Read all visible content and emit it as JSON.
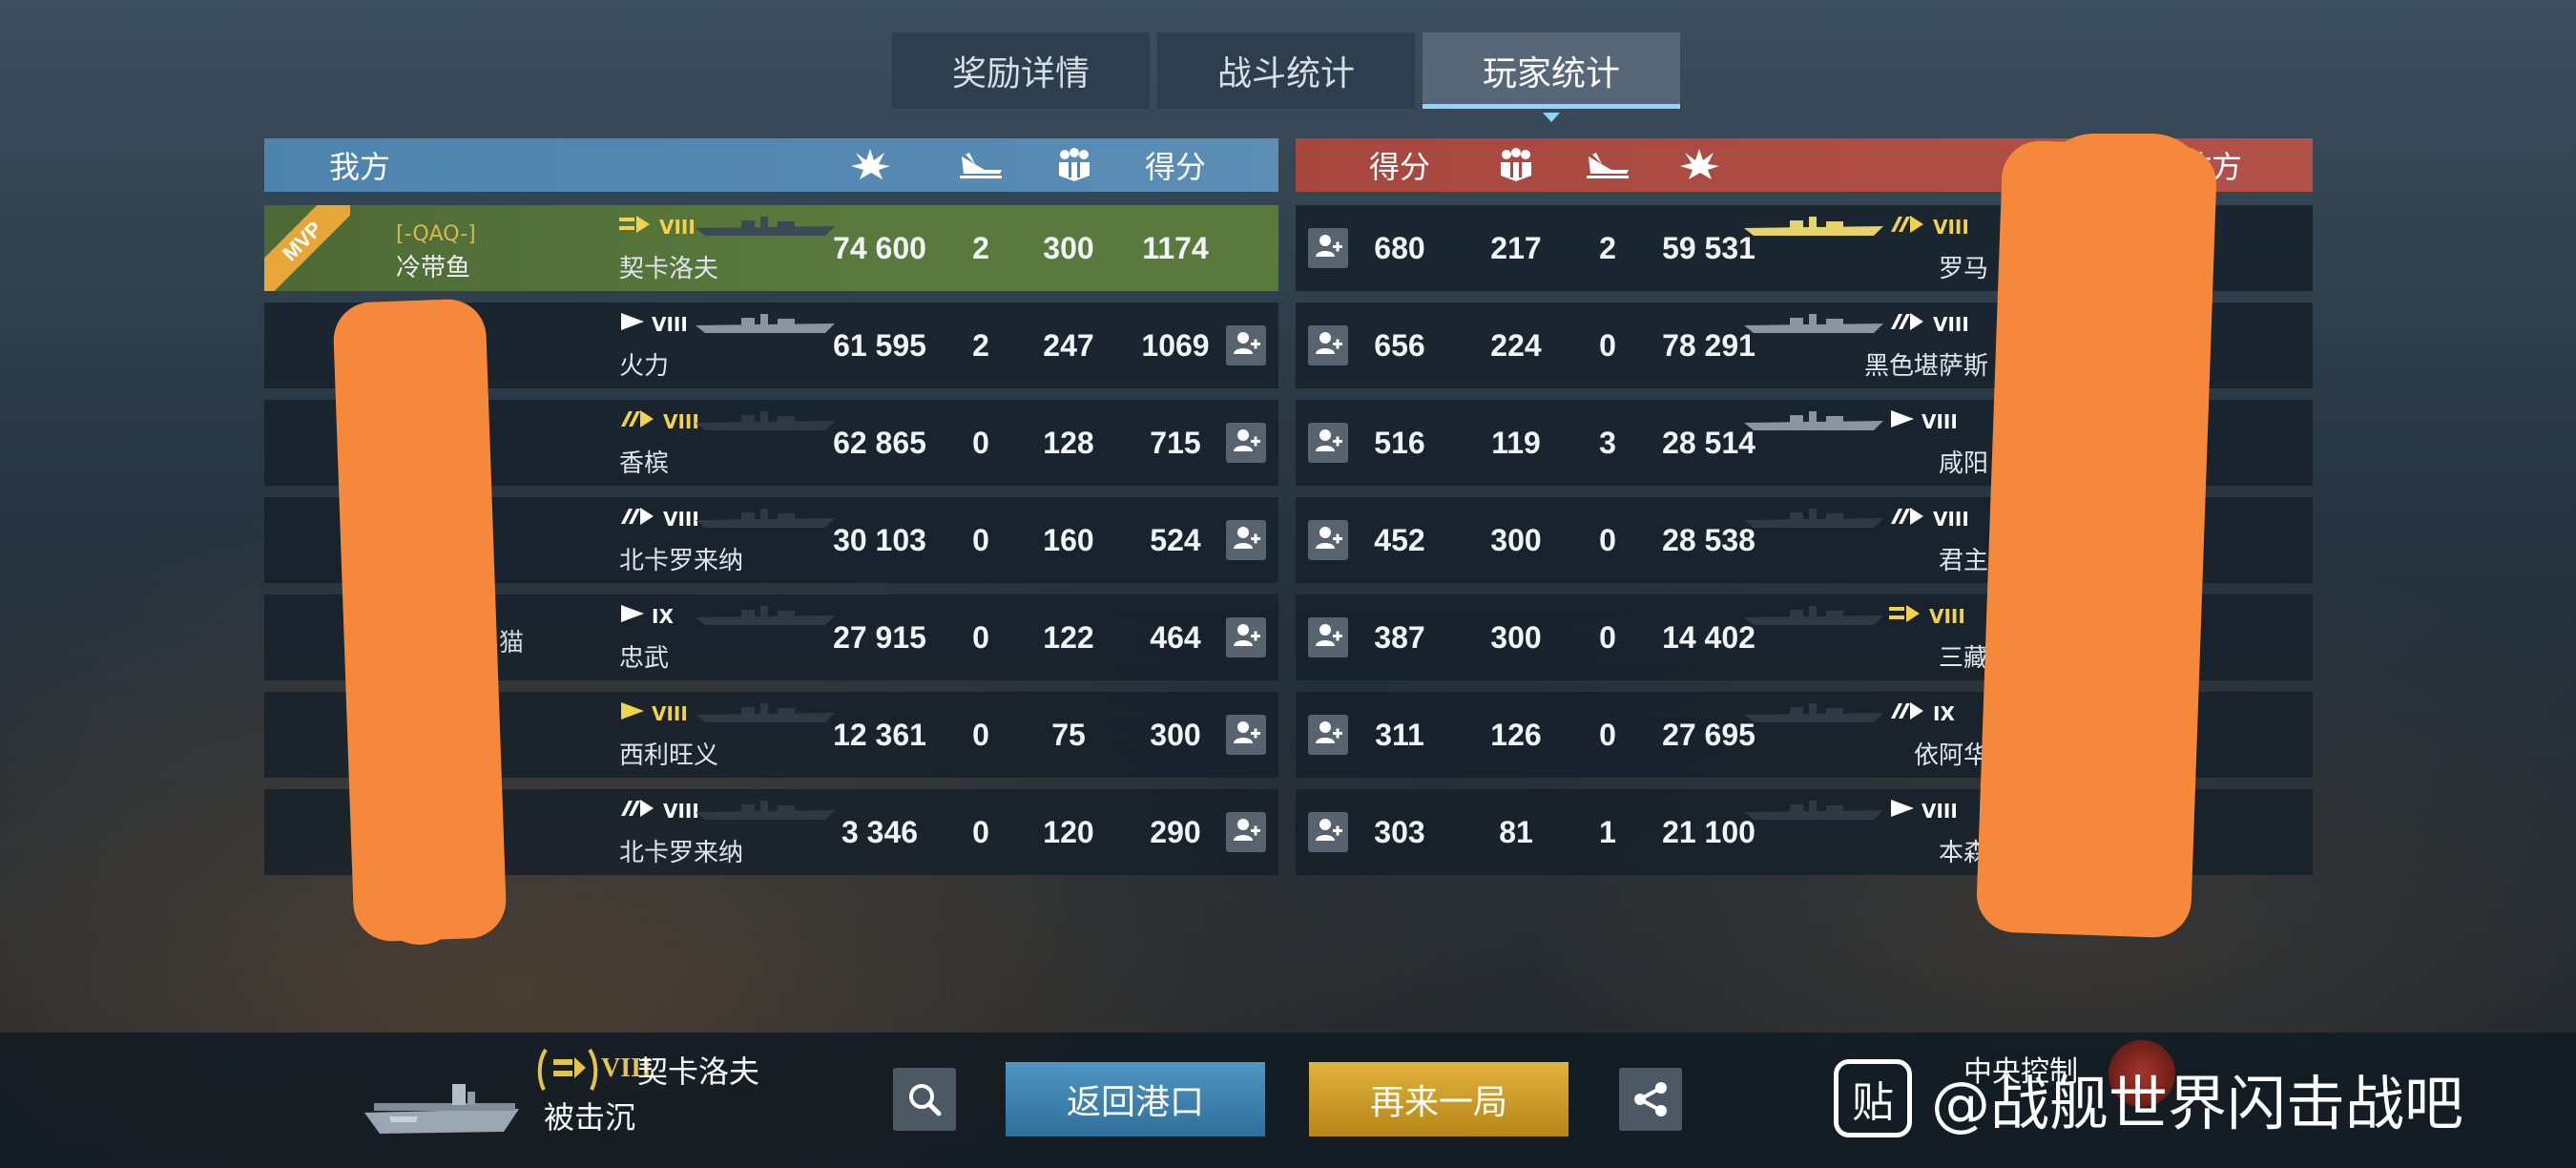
{
  "tabs": [
    {
      "label": "奖励详情",
      "active": false
    },
    {
      "label": "战斗统计",
      "active": false
    },
    {
      "label": "玩家统计",
      "active": true
    }
  ],
  "our_team": {
    "title": "我方",
    "score_label": "得分",
    "header_icons": [
      "damage-icon",
      "kills-icon",
      "capture-icon"
    ],
    "color": "#4d84ad"
  },
  "enemy_team": {
    "title": "敌方",
    "score_label": "得分",
    "header_icons": [
      "capture-icon",
      "kills-icon",
      "damage-icon"
    ],
    "color": "#a8473f"
  },
  "our_rows": [
    {
      "clan": "[-QAQ-]",
      "player": "冷带鱼",
      "mvp": true,
      "mvp_label": "MVP",
      "ship": "契卡洛夫",
      "tier": "VIII",
      "premium": true,
      "damage": "74 600",
      "kills": "2",
      "capture": "300",
      "score": "1174"
    },
    {
      "ship": "火力",
      "tier": "VIII",
      "premium": false,
      "damage": "61 595",
      "kills": "2",
      "capture": "247",
      "score": "1069"
    },
    {
      "ship": "香槟",
      "tier": "VIII",
      "premium": true,
      "damage": "62 865",
      "kills": "0",
      "capture": "128",
      "score": "715"
    },
    {
      "ship": "北卡罗来纳",
      "tier": "VIII",
      "premium": false,
      "damage": "30 103",
      "kills": "0",
      "capture": "160",
      "score": "524"
    },
    {
      "player_partial": "猫",
      "ship": "忠武",
      "tier": "IX",
      "premium": false,
      "damage": "27 915",
      "kills": "0",
      "capture": "122",
      "score": "464"
    },
    {
      "ship": "西利旺义",
      "tier": "VIII",
      "premium": true,
      "damage": "12 361",
      "kills": "0",
      "capture": "75",
      "score": "300"
    },
    {
      "ship": "北卡罗来纳",
      "tier": "VIII",
      "premium": false,
      "damage": "3 346",
      "kills": "0",
      "capture": "120",
      "score": "290"
    }
  ],
  "enemy_rows": [
    {
      "score": "680",
      "capture": "217",
      "kills": "2",
      "damage": "59 531",
      "ship": "罗马",
      "tier": "VIII",
      "premium": true
    },
    {
      "score": "656",
      "capture": "224",
      "kills": "0",
      "damage": "78 291",
      "ship": "黑色堪萨斯",
      "tier": "VIII",
      "premium": false
    },
    {
      "score": "516",
      "capture": "119",
      "kills": "3",
      "damage": "28 514",
      "ship": "咸阳",
      "tier": "VIII",
      "premium": false
    },
    {
      "score": "452",
      "capture": "300",
      "kills": "0",
      "damage": "28 538",
      "ship": "君主",
      "tier": "VIII",
      "premium": false
    },
    {
      "score": "387",
      "capture": "300",
      "kills": "0",
      "damage": "14 402",
      "ship": "三藏",
      "tier": "VIII",
      "premium": true
    },
    {
      "score": "311",
      "capture": "126",
      "kills": "0",
      "damage": "27 695",
      "ship": "依阿华",
      "tier": "IX",
      "premium": false
    },
    {
      "score": "303",
      "capture": "81",
      "kills": "1",
      "damage": "21 100",
      "ship": "本森",
      "tier": "VIII",
      "premium": false
    }
  ],
  "bottom": {
    "ship_tier": "VIII",
    "ship_name": "契卡洛夫",
    "status": "被击沉",
    "back_label": "返回港口",
    "again_label": "再来一局",
    "mode_label": "中央控制"
  },
  "watermark": {
    "logo_char": "贴",
    "text": "@战舰世界闪击战吧"
  }
}
